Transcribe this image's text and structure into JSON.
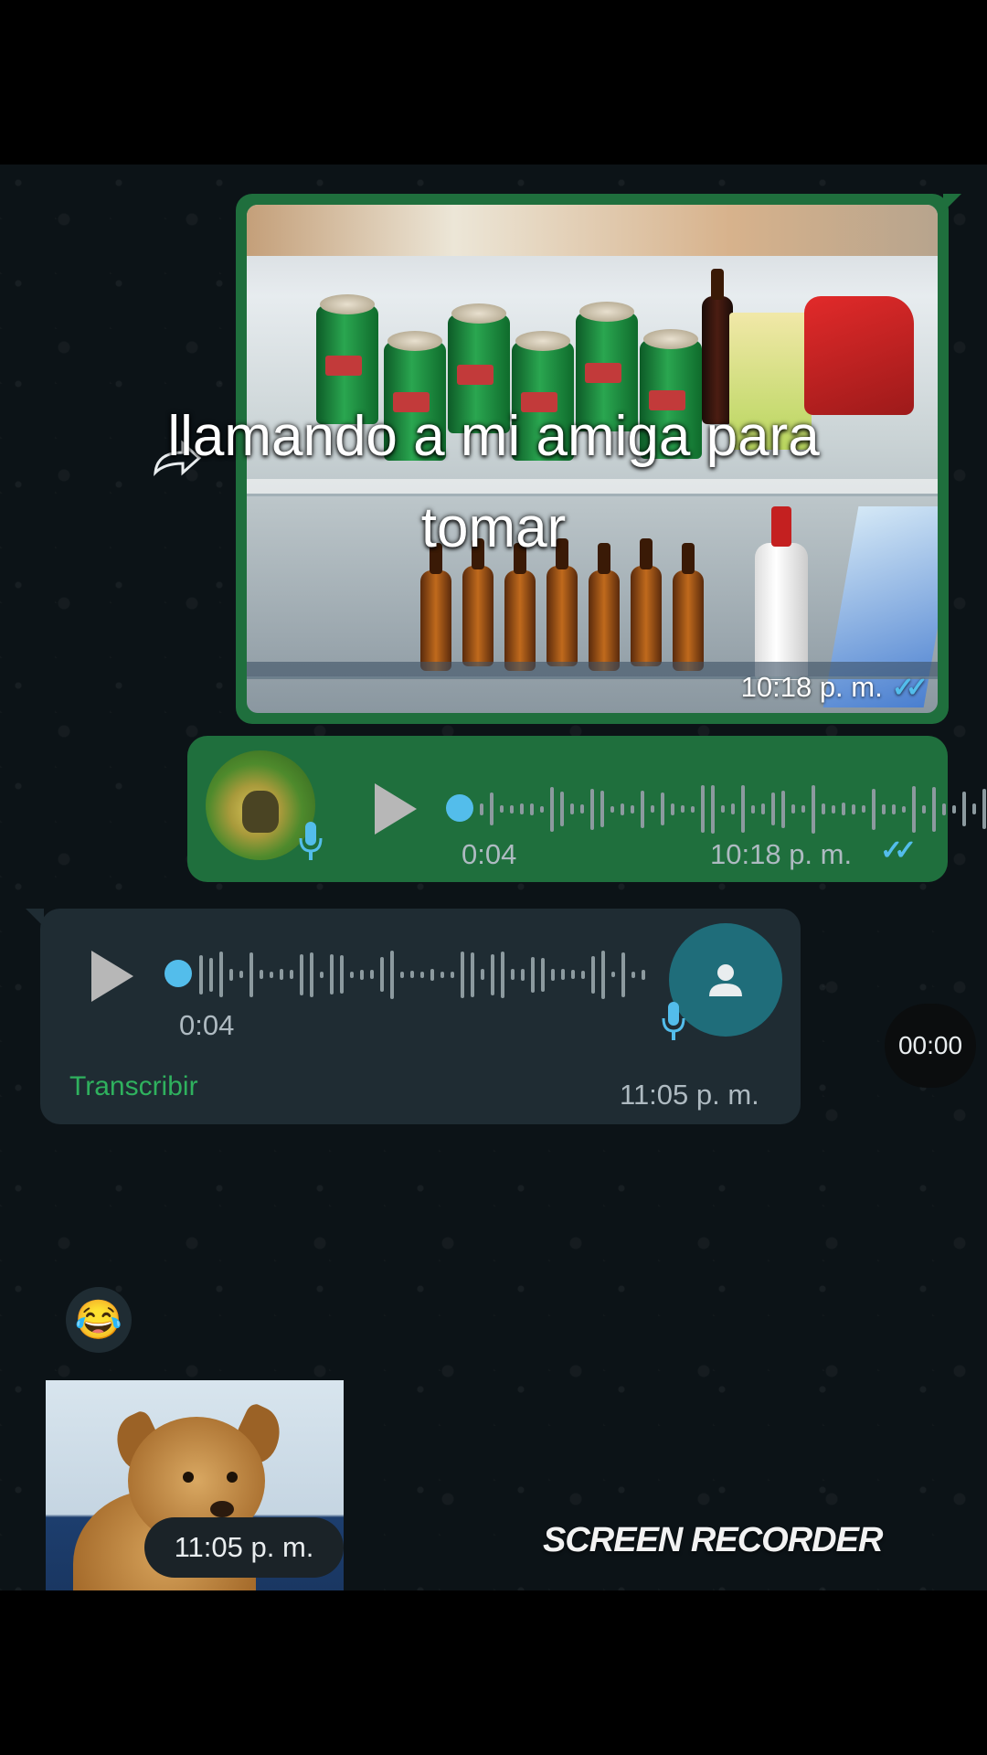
{
  "caption": {
    "line1": "llamando a mi amiga para",
    "line2": "tomar"
  },
  "messages": {
    "image_out": {
      "time": "10:18 p. m.",
      "status_icon": "double-check-icon",
      "read_color": "#53bdeb"
    },
    "audio_out": {
      "duration": "0:04",
      "time": "10:18 p. m.",
      "status_icon": "double-check-icon",
      "progress": 0
    },
    "audio_in": {
      "duration": "0:04",
      "time": "11:05 p. m.",
      "transcribe_label": "Transcribir",
      "progress": 0
    },
    "reaction": {
      "emoji": "😂"
    },
    "sticker": {
      "time": "11:05 p. m."
    }
  },
  "recorder": {
    "timer": "00:00",
    "watermark": "SCREEN RECORDER"
  },
  "colors": {
    "outgoing_bubble": "#1f6f3d",
    "incoming_bubble": "#1f2c33",
    "accent_blue": "#53bdeb",
    "transcribe_green": "#2fb15e"
  }
}
